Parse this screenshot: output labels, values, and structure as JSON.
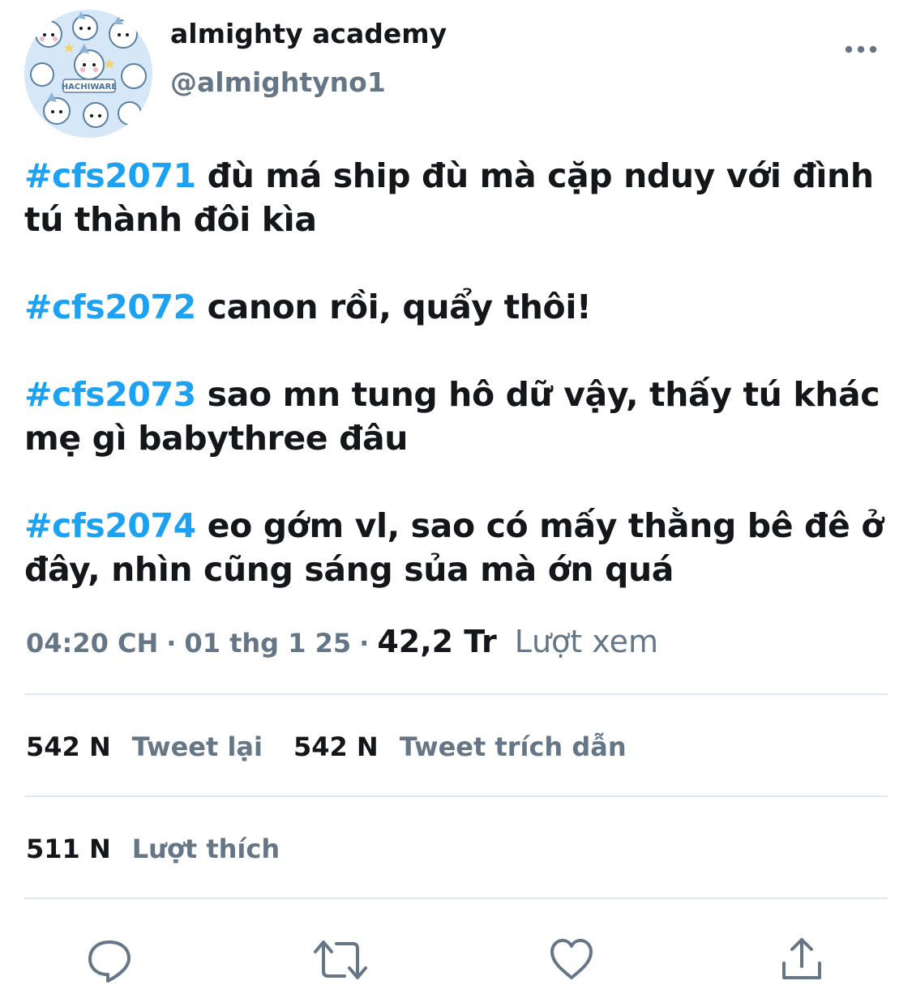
{
  "author": {
    "display_name": "almighty academy",
    "handle": "@almightyno1",
    "avatar_text": "HACHIWARE"
  },
  "tweet": {
    "paragraphs": [
      {
        "hashtag": "#cfs2071",
        "lines": [
          " đù má ship đù mà cặp nduy với đình",
          "tú thành đôi kìa"
        ]
      },
      {
        "hashtag": "#cfs2072",
        "lines": [
          " canon rồi, quẩy thôi!"
        ]
      },
      {
        "hashtag": "#cfs2073",
        "lines": [
          " sao mn tung hô dữ vậy, thấy tú khác",
          "mẹ gì babythree đâu"
        ]
      },
      {
        "hashtag": "#cfs2074",
        "lines": [
          " eo gớm vl, sao có mấy thằng bê đê ở",
          "đây, nhìn cũng sáng sủa mà ớn quá"
        ]
      }
    ]
  },
  "meta": {
    "time": "04:20 CH",
    "separator": "·",
    "date": "01 thg 1 25",
    "views_count": "42,2 Tr",
    "views_label": "Lượt xem"
  },
  "stats": {
    "retweets_count": "542 N",
    "retweets_label": "Tweet lại",
    "quotes_count": "542 N",
    "quotes_label": "Tweet trích dẫn",
    "likes_count": "511 N",
    "likes_label": "Lượt thích"
  },
  "icons": {
    "more": "more-horizontal-icon",
    "reply": "reply-icon",
    "retweet": "retweet-icon",
    "like": "heart-icon",
    "share": "share-icon"
  },
  "colors": {
    "hashtag": "#1da1f2",
    "secondary_text": "#657786",
    "primary_text": "#14171a",
    "divider": "#e1e8ed"
  }
}
